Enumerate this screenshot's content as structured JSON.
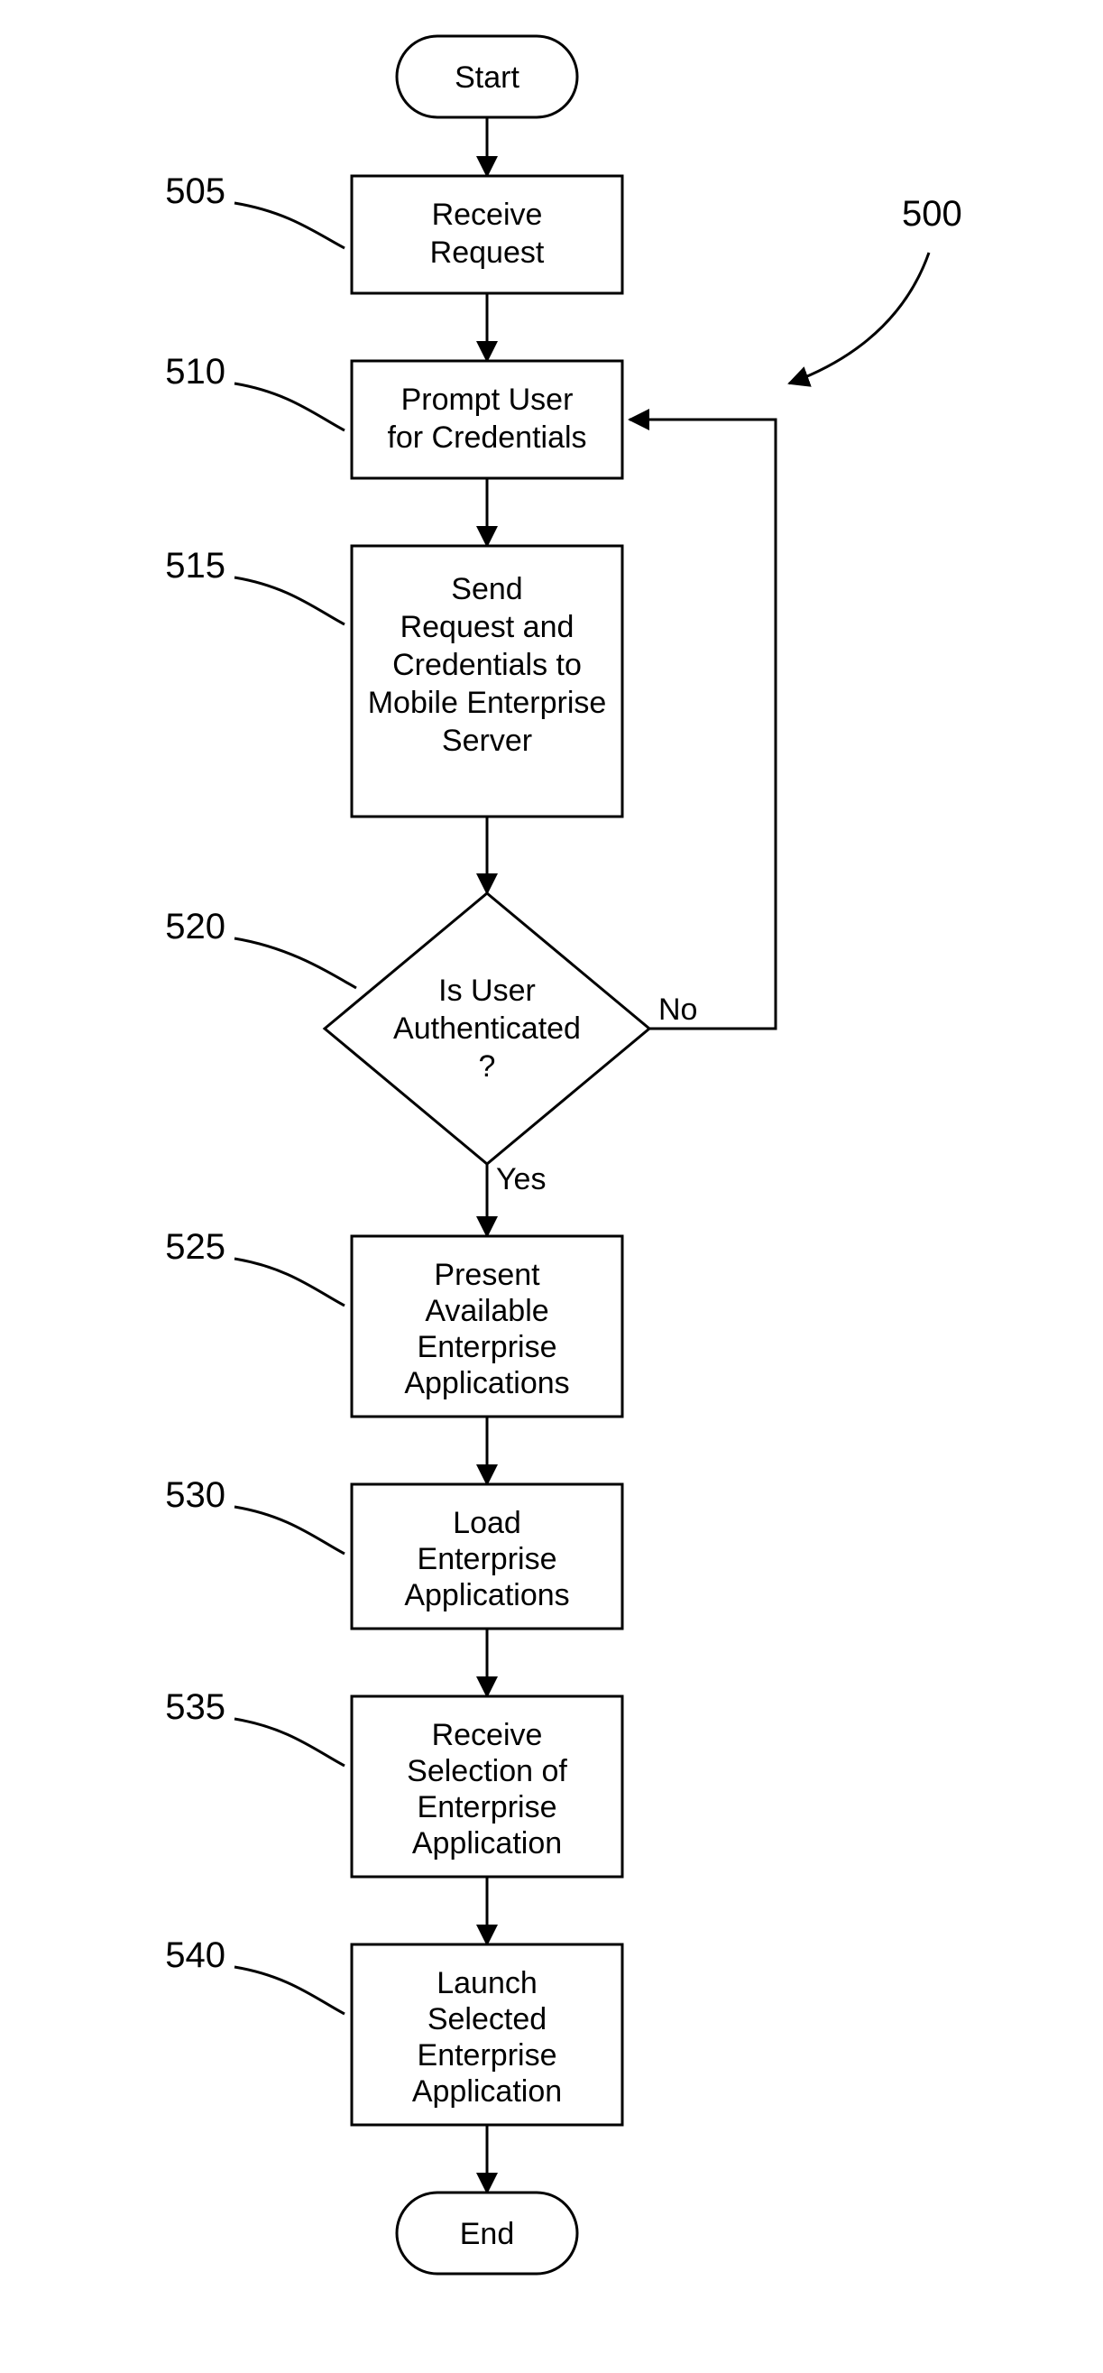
{
  "refs": {
    "figure": "500",
    "r505": "505",
    "r510": "510",
    "r515": "515",
    "r520": "520",
    "r525": "525",
    "r530": "530",
    "r535": "535",
    "r540": "540"
  },
  "nodes": {
    "start": "Start",
    "end": "End",
    "n505": "Receive Request",
    "n510": "Prompt User for Credentials",
    "n515": "Send Request and Credentials to Mobile Enterprise Server",
    "n520": "Is User Authenticated ?",
    "n525": "Present Available Enterprise Applications",
    "n530": "Load Enterprise Applications",
    "n535": "Receive Selection of Enterprise Application",
    "n540": "Launch Selected Enterprise Application"
  },
  "edges": {
    "yes": "Yes",
    "no": "No"
  }
}
